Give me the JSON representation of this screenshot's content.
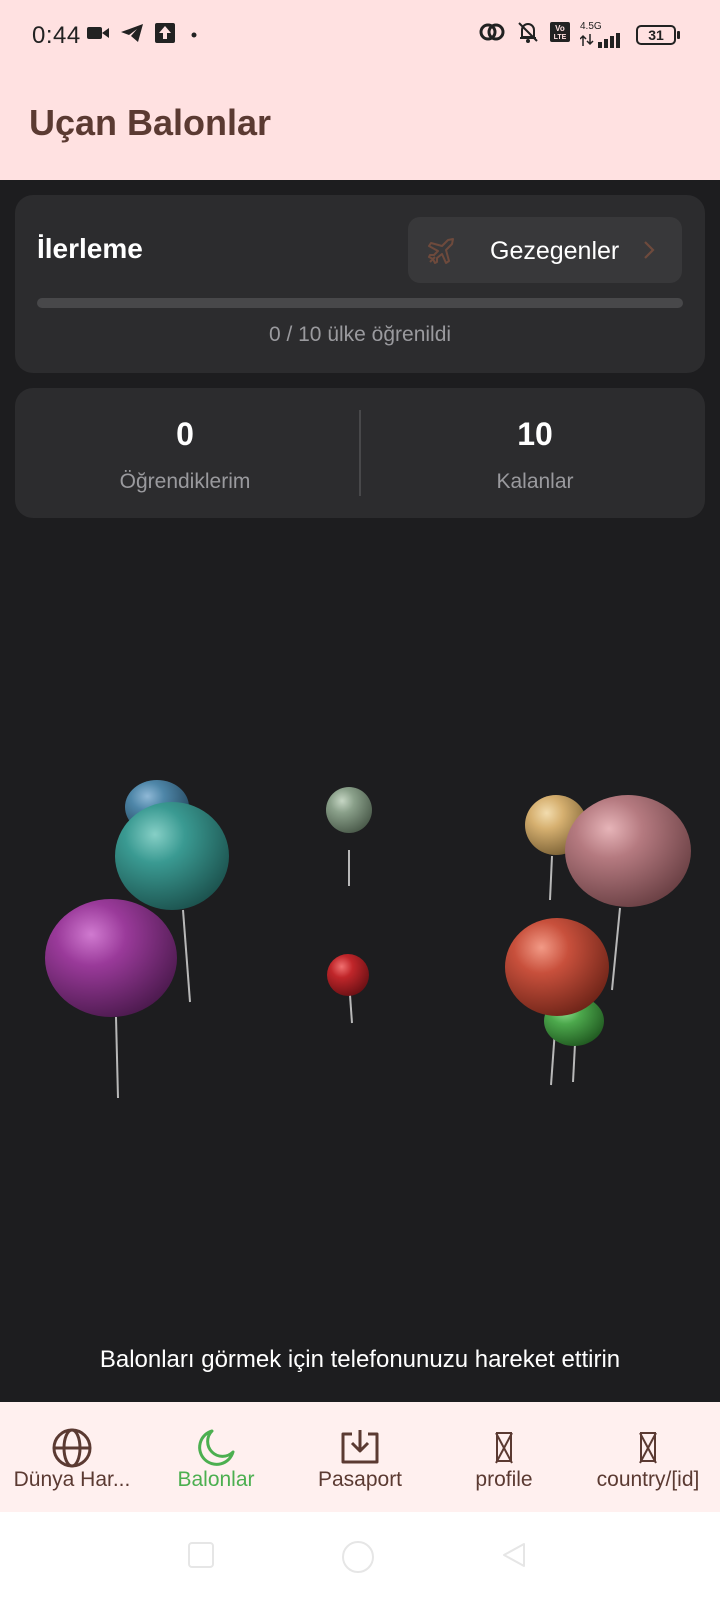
{
  "status_bar": {
    "time": "0:44",
    "network_label": "4.5G",
    "volte_label": "Vo LTE",
    "battery_level": "31",
    "left_icons": [
      "video-camera-icon",
      "telegram-icon",
      "upload-icon",
      "dot-icon"
    ],
    "right_icons": [
      "link-icon",
      "bell-off-icon",
      "volte-icon",
      "signal-icon",
      "battery-icon"
    ]
  },
  "app_bar": {
    "title": "Uçan Balonlar"
  },
  "progress_card": {
    "title": "İlerleme",
    "planets_button_label": "Gezegenler",
    "progress_text": "0 / 10 ülke öğrenildi",
    "progress_fraction": 0
  },
  "stats": {
    "learned_value": "0",
    "learned_label": "Öğrendiklerim",
    "remaining_value": "10",
    "remaining_label": "Kalanlar"
  },
  "balloons": {
    "count": 10,
    "colors": [
      "#4e86a8",
      "#3a9a92",
      "#9a3a9a",
      "#8aa08a",
      "#c0262a",
      "#d6b070",
      "#b57a80",
      "#c8503c",
      "#4ca84c",
      "#d4a06a"
    ]
  },
  "hint": "Balonları görmek için telefonunuzu hareket ettirin",
  "bottom_nav": {
    "items": [
      {
        "label": "Dünya Har...",
        "icon": "globe-icon",
        "active": false
      },
      {
        "label": "Balonlar",
        "icon": "moon-icon",
        "active": true
      },
      {
        "label": "Pasaport",
        "icon": "download-box-icon",
        "active": false
      },
      {
        "label": "profile",
        "icon": "missing-glyph-icon",
        "active": false
      },
      {
        "label": "country/[id]",
        "icon": "missing-glyph-icon",
        "active": false
      }
    ]
  },
  "colors": {
    "header_bg": "#ffe1e1",
    "screen_bg": "#1d1d1f",
    "card_bg": "#2c2c2e",
    "accent_brown": "#5b3a32",
    "active_green": "#4caf50"
  }
}
